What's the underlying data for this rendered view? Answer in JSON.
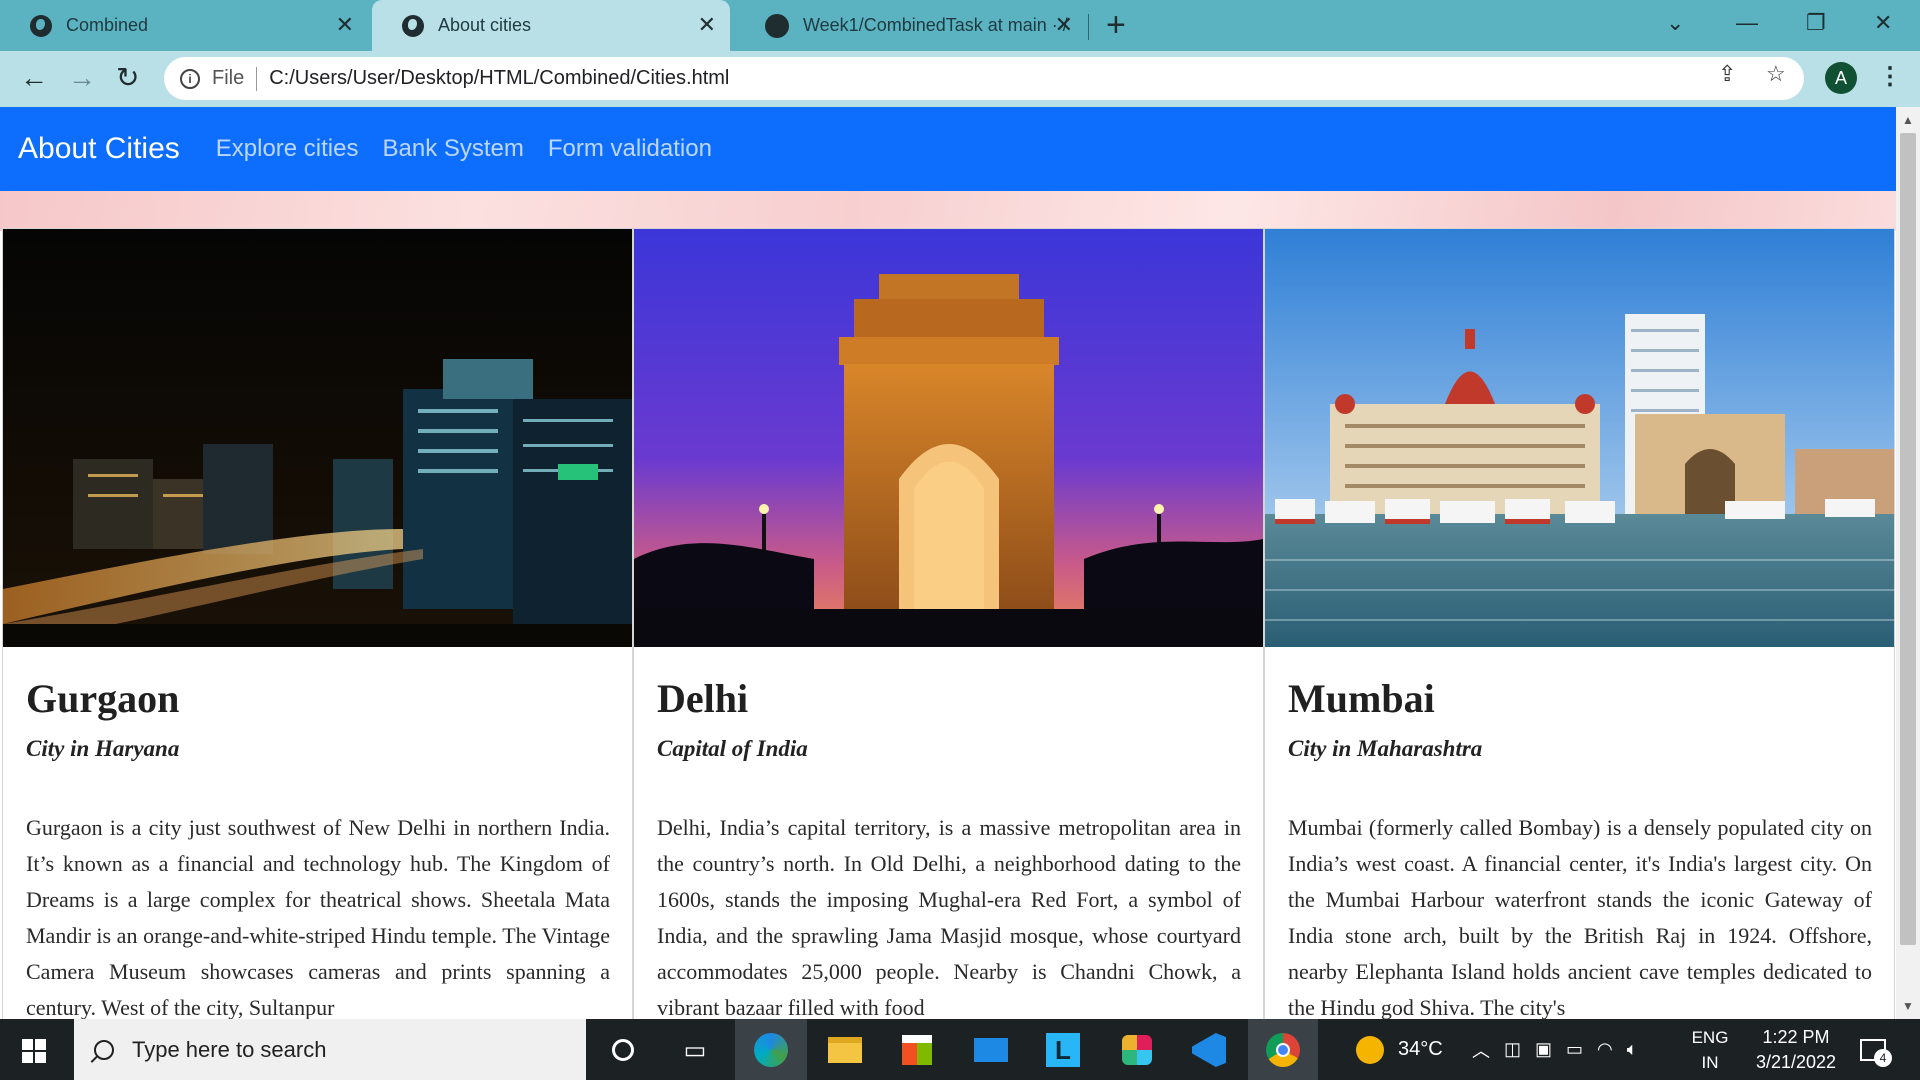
{
  "browser": {
    "tabs": [
      {
        "title": "Combined",
        "active": false
      },
      {
        "title": "About cities",
        "active": true
      },
      {
        "title": "Week1/CombinedTask at main · /",
        "active": false
      }
    ],
    "address": {
      "scheme_label": "File",
      "url": "C:/Users/User/Desktop/HTML/Combined/Cities.html"
    },
    "profile_initial": "A"
  },
  "navbar": {
    "brand": "About Cities",
    "links": [
      "Explore cities",
      "Bank System",
      "Form validation"
    ]
  },
  "cards": [
    {
      "title": "Gurgaon",
      "subtitle": "City in Haryana",
      "text": "Gurgaon is a city just southwest of New Delhi in northern India. It’s known as a financial and technology hub. The Kingdom of Dreams is a large complex for theatrical shows. Sheetala Mata Mandir is an orange-and-white-striped Hindu temple. The Vintage Camera Museum showcases cameras and prints spanning a century. West of the city, Sultanpur"
    },
    {
      "title": "Delhi",
      "subtitle": "Capital of India",
      "text": "Delhi, India’s capital territory, is a massive metropolitan area in the country’s north. In Old Delhi, a neighborhood dating to the 1600s, stands the imposing Mughal-era Red Fort, a symbol of India, and the sprawling Jama Masjid mosque, whose courtyard accommodates 25,000 people. Nearby is Chandni Chowk, a vibrant bazaar filled with food"
    },
    {
      "title": "Mumbai",
      "subtitle": "City in Maharashtra",
      "text": "Mumbai (formerly called Bombay) is a densely populated city on India’s west coast. A financial center, it's India's largest city. On the Mumbai Harbour waterfront stands the iconic Gateway of India stone arch, built by the British Raj in 1924. Offshore, nearby Elephanta Island holds ancient cave temples dedicated to the Hindu god Shiva. The city's"
    }
  ],
  "taskbar": {
    "search_placeholder": "Type here to search",
    "weather": "34°C",
    "lang_top": "ENG",
    "lang_bottom": "IN",
    "time": "1:22 PM",
    "date": "3/21/2022",
    "notification_count": "4"
  }
}
